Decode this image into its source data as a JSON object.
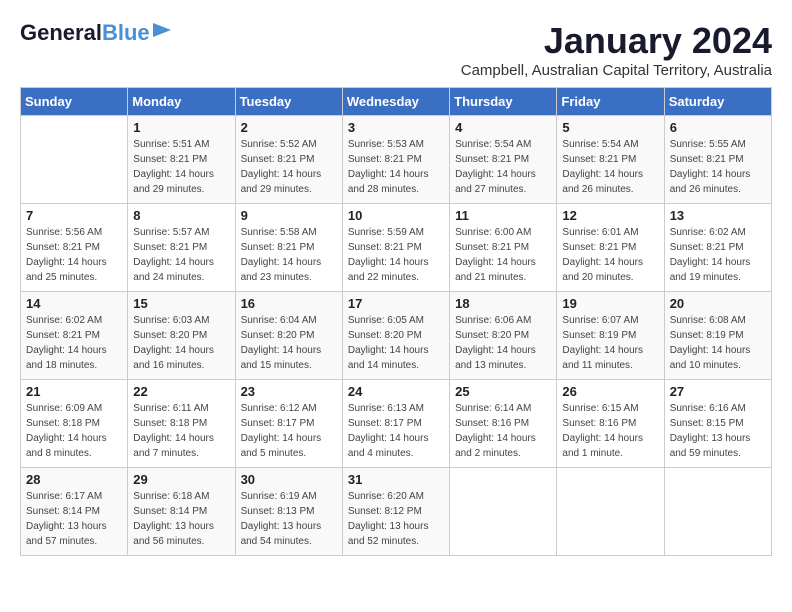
{
  "logo": {
    "general": "General",
    "blue": "Blue"
  },
  "title": "January 2024",
  "location": "Campbell, Australian Capital Territory, Australia",
  "days_of_week": [
    "Sunday",
    "Monday",
    "Tuesday",
    "Wednesday",
    "Thursday",
    "Friday",
    "Saturday"
  ],
  "weeks": [
    [
      {
        "day": "",
        "info": ""
      },
      {
        "day": "1",
        "info": "Sunrise: 5:51 AM\nSunset: 8:21 PM\nDaylight: 14 hours\nand 29 minutes."
      },
      {
        "day": "2",
        "info": "Sunrise: 5:52 AM\nSunset: 8:21 PM\nDaylight: 14 hours\nand 29 minutes."
      },
      {
        "day": "3",
        "info": "Sunrise: 5:53 AM\nSunset: 8:21 PM\nDaylight: 14 hours\nand 28 minutes."
      },
      {
        "day": "4",
        "info": "Sunrise: 5:54 AM\nSunset: 8:21 PM\nDaylight: 14 hours\nand 27 minutes."
      },
      {
        "day": "5",
        "info": "Sunrise: 5:54 AM\nSunset: 8:21 PM\nDaylight: 14 hours\nand 26 minutes."
      },
      {
        "day": "6",
        "info": "Sunrise: 5:55 AM\nSunset: 8:21 PM\nDaylight: 14 hours\nand 26 minutes."
      }
    ],
    [
      {
        "day": "7",
        "info": "Sunrise: 5:56 AM\nSunset: 8:21 PM\nDaylight: 14 hours\nand 25 minutes."
      },
      {
        "day": "8",
        "info": "Sunrise: 5:57 AM\nSunset: 8:21 PM\nDaylight: 14 hours\nand 24 minutes."
      },
      {
        "day": "9",
        "info": "Sunrise: 5:58 AM\nSunset: 8:21 PM\nDaylight: 14 hours\nand 23 minutes."
      },
      {
        "day": "10",
        "info": "Sunrise: 5:59 AM\nSunset: 8:21 PM\nDaylight: 14 hours\nand 22 minutes."
      },
      {
        "day": "11",
        "info": "Sunrise: 6:00 AM\nSunset: 8:21 PM\nDaylight: 14 hours\nand 21 minutes."
      },
      {
        "day": "12",
        "info": "Sunrise: 6:01 AM\nSunset: 8:21 PM\nDaylight: 14 hours\nand 20 minutes."
      },
      {
        "day": "13",
        "info": "Sunrise: 6:02 AM\nSunset: 8:21 PM\nDaylight: 14 hours\nand 19 minutes."
      }
    ],
    [
      {
        "day": "14",
        "info": "Sunrise: 6:02 AM\nSunset: 8:21 PM\nDaylight: 14 hours\nand 18 minutes."
      },
      {
        "day": "15",
        "info": "Sunrise: 6:03 AM\nSunset: 8:20 PM\nDaylight: 14 hours\nand 16 minutes."
      },
      {
        "day": "16",
        "info": "Sunrise: 6:04 AM\nSunset: 8:20 PM\nDaylight: 14 hours\nand 15 minutes."
      },
      {
        "day": "17",
        "info": "Sunrise: 6:05 AM\nSunset: 8:20 PM\nDaylight: 14 hours\nand 14 minutes."
      },
      {
        "day": "18",
        "info": "Sunrise: 6:06 AM\nSunset: 8:20 PM\nDaylight: 14 hours\nand 13 minutes."
      },
      {
        "day": "19",
        "info": "Sunrise: 6:07 AM\nSunset: 8:19 PM\nDaylight: 14 hours\nand 11 minutes."
      },
      {
        "day": "20",
        "info": "Sunrise: 6:08 AM\nSunset: 8:19 PM\nDaylight: 14 hours\nand 10 minutes."
      }
    ],
    [
      {
        "day": "21",
        "info": "Sunrise: 6:09 AM\nSunset: 8:18 PM\nDaylight: 14 hours\nand 8 minutes."
      },
      {
        "day": "22",
        "info": "Sunrise: 6:11 AM\nSunset: 8:18 PM\nDaylight: 14 hours\nand 7 minutes."
      },
      {
        "day": "23",
        "info": "Sunrise: 6:12 AM\nSunset: 8:17 PM\nDaylight: 14 hours\nand 5 minutes."
      },
      {
        "day": "24",
        "info": "Sunrise: 6:13 AM\nSunset: 8:17 PM\nDaylight: 14 hours\nand 4 minutes."
      },
      {
        "day": "25",
        "info": "Sunrise: 6:14 AM\nSunset: 8:16 PM\nDaylight: 14 hours\nand 2 minutes."
      },
      {
        "day": "26",
        "info": "Sunrise: 6:15 AM\nSunset: 8:16 PM\nDaylight: 14 hours\nand 1 minute."
      },
      {
        "day": "27",
        "info": "Sunrise: 6:16 AM\nSunset: 8:15 PM\nDaylight: 13 hours\nand 59 minutes."
      }
    ],
    [
      {
        "day": "28",
        "info": "Sunrise: 6:17 AM\nSunset: 8:14 PM\nDaylight: 13 hours\nand 57 minutes."
      },
      {
        "day": "29",
        "info": "Sunrise: 6:18 AM\nSunset: 8:14 PM\nDaylight: 13 hours\nand 56 minutes."
      },
      {
        "day": "30",
        "info": "Sunrise: 6:19 AM\nSunset: 8:13 PM\nDaylight: 13 hours\nand 54 minutes."
      },
      {
        "day": "31",
        "info": "Sunrise: 6:20 AM\nSunset: 8:12 PM\nDaylight: 13 hours\nand 52 minutes."
      },
      {
        "day": "",
        "info": ""
      },
      {
        "day": "",
        "info": ""
      },
      {
        "day": "",
        "info": ""
      }
    ]
  ]
}
